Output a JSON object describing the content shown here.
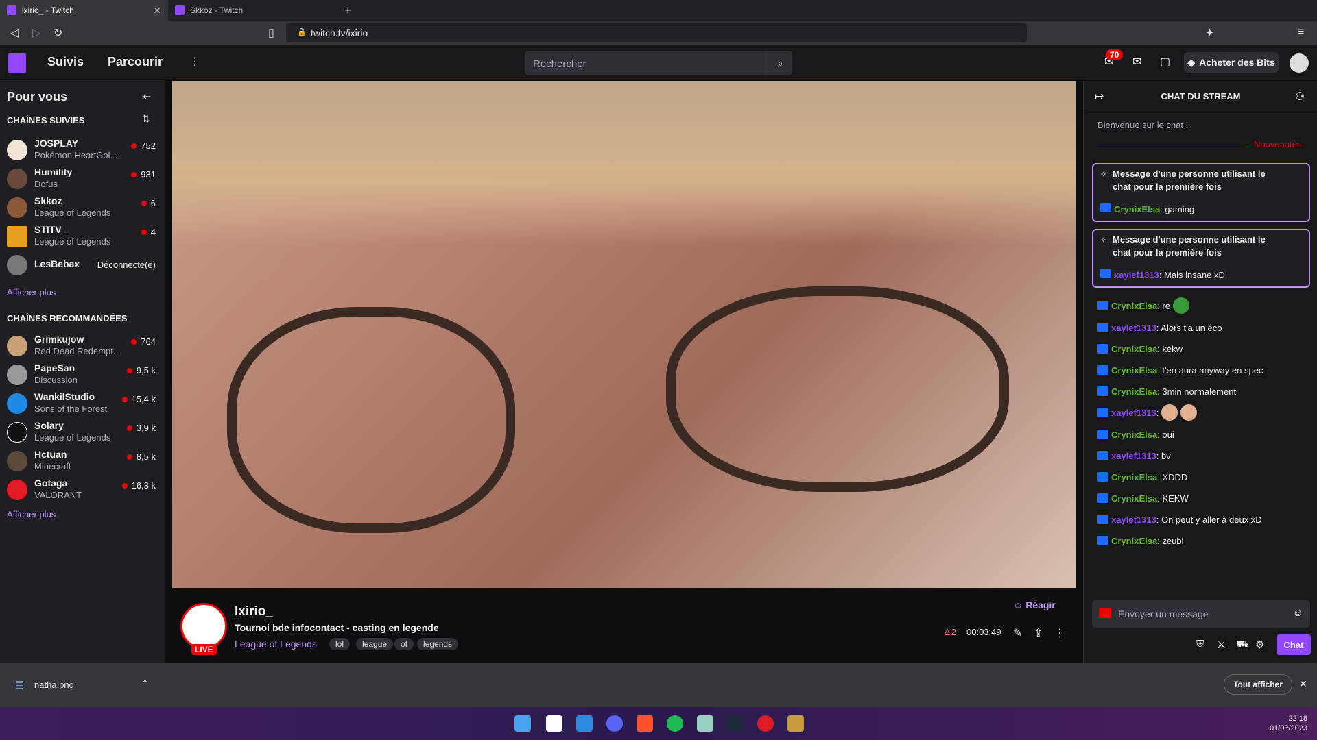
{
  "browser": {
    "tabs": [
      {
        "label": "lxirio_ - Twitch"
      },
      {
        "label": "Skkoz - Twitch"
      }
    ],
    "url": "twitch.tv/ixirio_"
  },
  "topnav": {
    "following": "Suivis",
    "browse": "Parcourir",
    "search_placeholder": "Rechercher",
    "notif_count": "70",
    "bits": "Acheter des Bits"
  },
  "sidebar": {
    "title": "Pour vous",
    "followed_header": "CHAÎNES SUIVIES",
    "followed": [
      {
        "name": "JOSPLAY",
        "game": "Pokémon HeartGol...",
        "viewers": "752"
      },
      {
        "name": "Humility",
        "game": "Dofus",
        "viewers": "931"
      },
      {
        "name": "Skkoz",
        "game": "League of Legends",
        "viewers": "6"
      },
      {
        "name": "STITV_",
        "game": "League of Legends",
        "viewers": "4"
      },
      {
        "name": "LesBebax",
        "game": "",
        "viewers": "Déconnecté(e)"
      }
    ],
    "show_more": "Afficher plus",
    "recommended_header": "CHAÎNES RECOMMANDÉES",
    "recommended": [
      {
        "name": "Grimkujow",
        "game": "Red Dead Redempt...",
        "viewers": "764"
      },
      {
        "name": "PapeSan",
        "game": "Discussion",
        "viewers": "9,5 k"
      },
      {
        "name": "WankilStudio",
        "game": "Sons of the Forest",
        "viewers": "15,4 k"
      },
      {
        "name": "Solary",
        "game": "League of Legends",
        "viewers": "3,9 k"
      },
      {
        "name": "Hctuan",
        "game": "Minecraft",
        "viewers": "8,5 k"
      },
      {
        "name": "Gotaga",
        "game": "VALORANT",
        "viewers": "16,3 k"
      }
    ],
    "show_more2": "Afficher plus"
  },
  "stream": {
    "streamer": "Ixirio_",
    "live": "LIVE",
    "title": "Tournoi bde infocontact - casting en legende",
    "game": "League of Legends",
    "tags": [
      "lol",
      "league",
      "of",
      "legends"
    ],
    "react": "Réagir",
    "viewers": "2",
    "uptime": "00:03:49"
  },
  "chat": {
    "title": "CHAT DU STREAM",
    "welcome": "Bienvenue sur le chat !",
    "new": "Nouveautés",
    "first_header": "Message d'une personne utilisant le chat pour la première fois",
    "first": [
      {
        "user": "CrynixElsa",
        "text": ": gaming",
        "color": "green"
      },
      {
        "user": "xaylef1313",
        "text": ": Mais insane xD",
        "color": "purple"
      }
    ],
    "messages": [
      {
        "user": "CrynixElsa",
        "text": ": re",
        "color": "green",
        "emote": true
      },
      {
        "user": "xaylef1313",
        "text": ": Alors t'a un éco",
        "color": "purple"
      },
      {
        "user": "CrynixElsa",
        "text": ": kekw",
        "color": "green"
      },
      {
        "user": "CrynixElsa",
        "text": ": t'en aura anyway en spec",
        "color": "green"
      },
      {
        "user": "CrynixElsa",
        "text": ": 3min normalement",
        "color": "green"
      },
      {
        "user": "xaylef1313",
        "text": ":",
        "color": "purple",
        "emote": true
      },
      {
        "user": "CrynixElsa",
        "text": ": oui",
        "color": "green"
      },
      {
        "user": "xaylef1313",
        "text": ": bv",
        "color": "purple"
      },
      {
        "user": "CrynixElsa",
        "text": ": XDDD",
        "color": "green"
      },
      {
        "user": "CrynixElsa",
        "text": ": KEKW",
        "color": "green"
      },
      {
        "user": "xaylef1313",
        "text": ": On peut y aller à deux xD",
        "color": "purple"
      },
      {
        "user": "CrynixElsa",
        "text": ": zeubi",
        "color": "green"
      }
    ],
    "input_placeholder": "Envoyer un message",
    "send": "Chat"
  },
  "downloads": {
    "file": "natha.png",
    "show_all": "Tout afficher"
  },
  "clock": {
    "time": "22:18",
    "date": "01/03/2023"
  }
}
